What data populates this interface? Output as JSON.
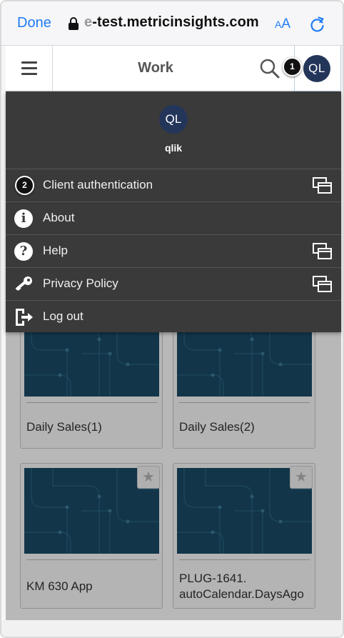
{
  "browser": {
    "done_label": "Done",
    "url_faded": "e",
    "url_text": "-test.metricinsights.com",
    "text_size_small": "A",
    "text_size_large": "A"
  },
  "app_bar": {
    "title": "Work",
    "avatar_initials": "QL"
  },
  "callouts": {
    "one": "1",
    "two": "2"
  },
  "user_menu": {
    "avatar_initials": "QL",
    "username": "qlik",
    "items": [
      {
        "label": "Client authentication",
        "icon": "key-icon",
        "external": true
      },
      {
        "label": "About",
        "icon": "info-icon",
        "external": false
      },
      {
        "label": "Help",
        "icon": "help-icon",
        "external": true
      },
      {
        "label": "Privacy Policy",
        "icon": "key-icon",
        "external": true
      },
      {
        "label": "Log out",
        "icon": "logout-icon",
        "external": false
      }
    ]
  },
  "apps": [
    {
      "name": "Daily Sales(1)",
      "starred": false
    },
    {
      "name": "Daily Sales(2)",
      "starred": false
    },
    {
      "name": "KM 630 App",
      "starred": false,
      "star_icon": "★"
    },
    {
      "name_line1": "PLUG-1641.",
      "name_line2": "autoCalendar.DaysAgo",
      "starred": false,
      "star_icon": "★"
    }
  ],
  "colors": {
    "accent": "#1e7cf5",
    "avatar": "#24355a",
    "menu_bg": "#3a3a3a",
    "thumb": "#1a4a66"
  }
}
